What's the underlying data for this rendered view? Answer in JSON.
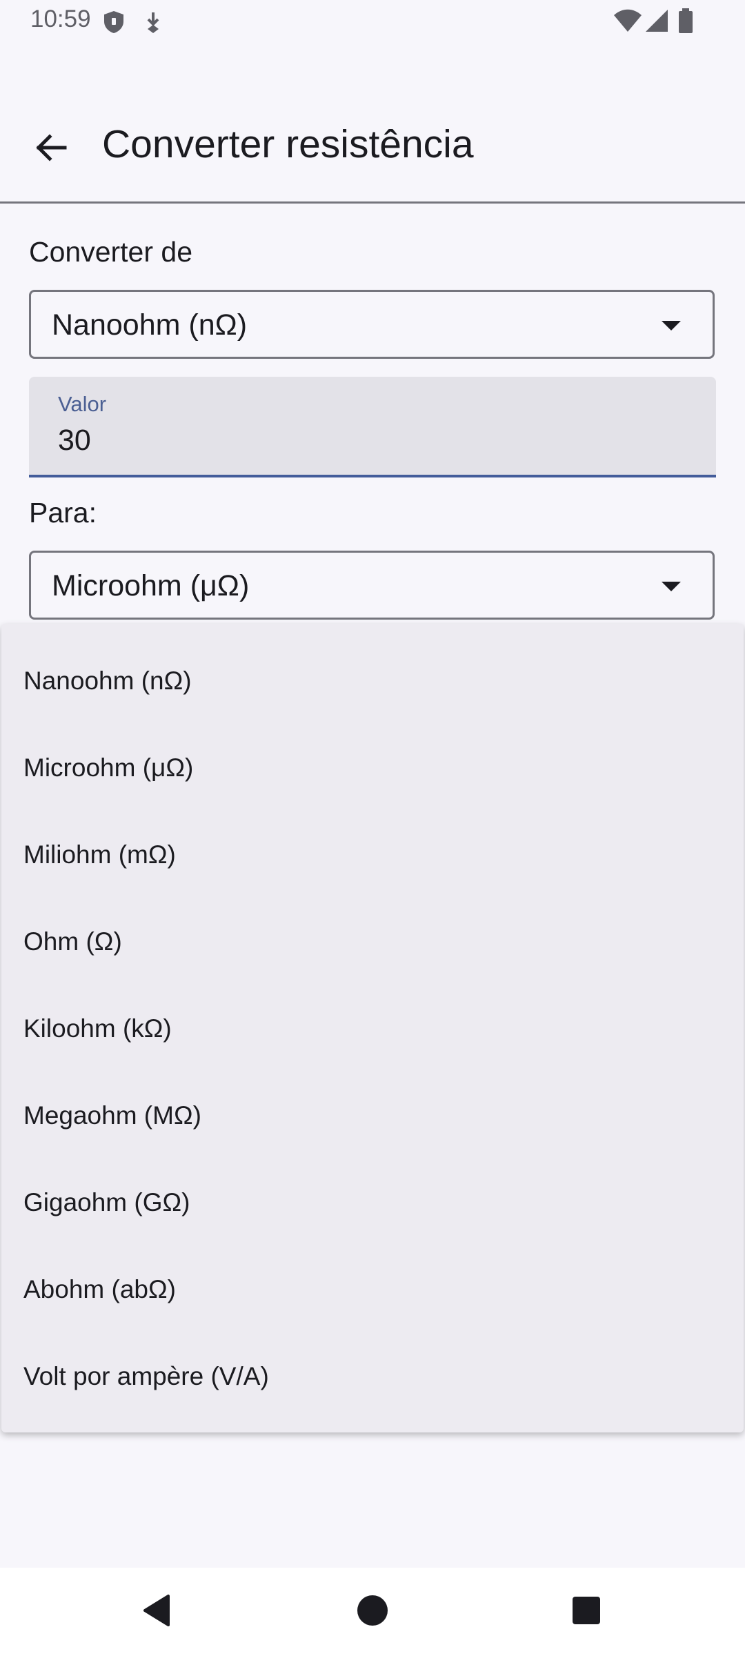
{
  "status_bar": {
    "time": "10:59",
    "icons": [
      "shield-icon",
      "download-icon",
      "wifi-icon",
      "cell-signal-icon",
      "battery-icon"
    ]
  },
  "app_bar": {
    "title": "Converter resistência",
    "back_icon": "arrow-back-icon"
  },
  "form": {
    "from_label": "Converter de",
    "from_value": "Nanoohm (nΩ)",
    "value_label": "Valor",
    "value": "30",
    "to_label": "Para:",
    "to_value": "Microohm (μΩ)"
  },
  "dropdown": {
    "items": [
      "Nanoohm (nΩ)",
      "Microohm (μΩ)",
      "Miliohm (mΩ)",
      "Ohm (Ω)",
      "Kiloohm (kΩ)",
      "Megaohm (MΩ)",
      "Gigaohm (GΩ)",
      "Abohm (abΩ)",
      "Volt por ampère (V/A)"
    ]
  },
  "nav_bar": {
    "icons": [
      "nav-back-icon",
      "nav-home-icon",
      "nav-recents-icon"
    ]
  },
  "colors": {
    "background": "#f7f6fb",
    "menu_background": "#edebf1",
    "field_background": "#e3e2e8",
    "accent": "#435c9a",
    "text": "#1b1b20"
  }
}
